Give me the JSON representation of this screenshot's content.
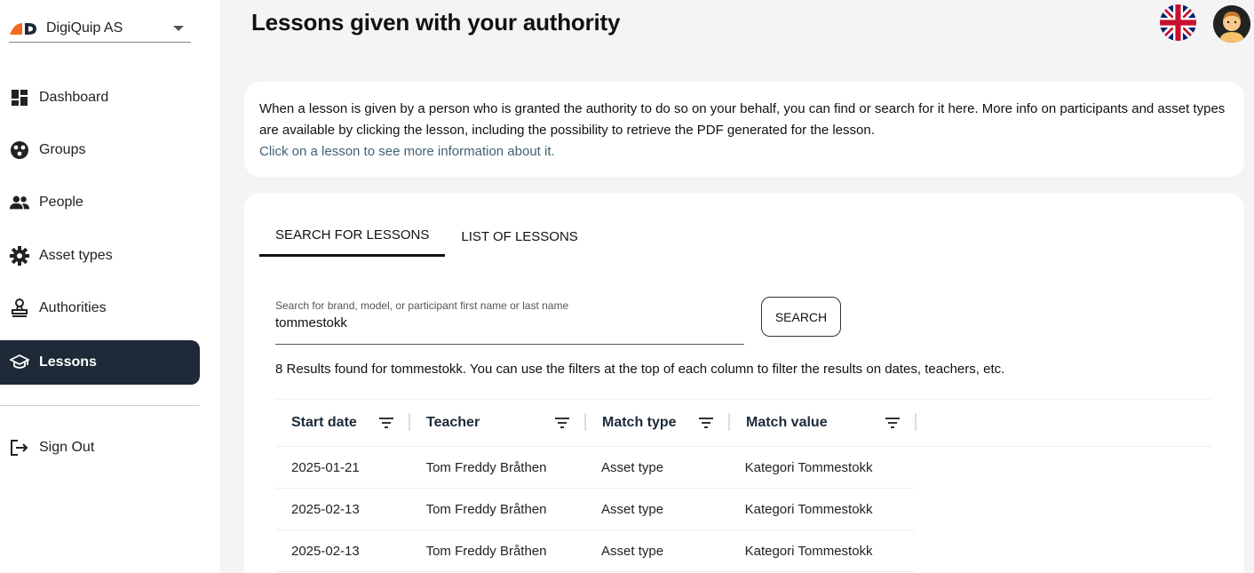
{
  "org": {
    "name": "DigiQuip AS",
    "logo": "digiquip-logo",
    "accent": "#f26a21"
  },
  "nav": {
    "items": [
      {
        "label": "Dashboard",
        "icon": "dashboard-icon"
      },
      {
        "label": "Groups",
        "icon": "groups-icon"
      },
      {
        "label": "People",
        "icon": "people-icon"
      },
      {
        "label": "Asset types",
        "icon": "gear-icon"
      },
      {
        "label": "Authorities",
        "icon": "stamp-icon"
      },
      {
        "label": "Lessons",
        "icon": "school-icon",
        "active": true
      }
    ],
    "sign_out": "Sign Out"
  },
  "header": {
    "title": "Lessons given with your authority",
    "language": "uk-flag-icon",
    "avatar": "avatar"
  },
  "info": {
    "text": "When a lesson is given by a person who is granted the authority to do so on your behalf, you can find or search for it here. More info on participants and asset types are available by clicking the lesson, including the possibility to retrieve the PDF generated for the lesson.",
    "hint": "Click on a lesson to see more information about it."
  },
  "tabs": [
    {
      "label": "SEARCH FOR LESSONS",
      "active": true
    },
    {
      "label": "LIST OF LESSONS"
    }
  ],
  "search": {
    "label": "Search for brand, model, or participant first name or last name",
    "value": "tommestokk",
    "button": "SEARCH"
  },
  "results_text": "8 Results found for tommestokk. You can use the filters at the top of each column to filter the results on dates, teachers, etc.",
  "table": {
    "columns": [
      "Start date",
      "Teacher",
      "Match type",
      "Match value"
    ],
    "rows": [
      [
        "2025-01-21",
        "Tom Freddy Bråthen",
        "Asset type",
        "Kategori Tommestokk"
      ],
      [
        "2025-02-13",
        "Tom Freddy Bråthen",
        "Asset type",
        "Kategori Tommestokk"
      ],
      [
        "2025-02-13",
        "Tom Freddy Bråthen",
        "Asset type",
        "Kategori Tommestokk"
      ]
    ]
  },
  "colors": {
    "sidebar_active": "#1e2a38",
    "hint": "#3f6274",
    "background": "#f4f4f4"
  }
}
